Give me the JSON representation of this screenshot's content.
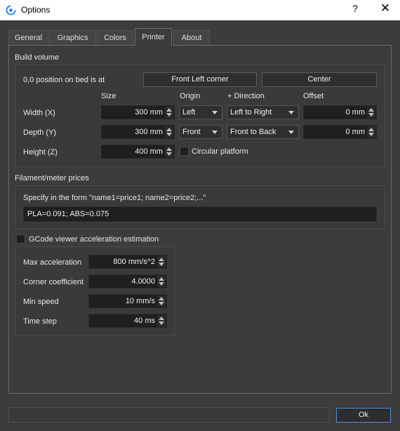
{
  "window": {
    "title": "Options",
    "help_glyph": "?",
    "close_glyph": "✕"
  },
  "tabs": [
    {
      "label": "General"
    },
    {
      "label": "Graphics"
    },
    {
      "label": "Colors"
    },
    {
      "label": "Printer",
      "active": true
    },
    {
      "label": "About"
    }
  ],
  "build_volume": {
    "title": "Build volume",
    "origin_position_label": "0,0 position on bed is at",
    "origin_buttons": [
      "Front Left corner",
      "Center"
    ],
    "columns": {
      "size": "Size",
      "origin": "Origin",
      "direction": "+ Direction",
      "offset": "Offset"
    },
    "rows": {
      "width": {
        "label": "Width (X)",
        "size": "300 mm",
        "origin": "Left",
        "direction": "Left to Right",
        "offset": "0 mm"
      },
      "depth": {
        "label": "Depth (Y)",
        "size": "300 mm",
        "origin": "Front",
        "direction": "Front to Back",
        "offset": "0 mm"
      },
      "height": {
        "label": "Height (Z)",
        "size": "400 mm"
      }
    },
    "circular_platform": {
      "label": "Circular platform",
      "checked": false
    }
  },
  "filament": {
    "title": "Filament/meter prices",
    "hint": "Specify in the form \"name1=price1; name2=price2;...\"",
    "value": "PLA=0.091; ABS=0.075"
  },
  "gcode_viewer": {
    "title": "GCode viewer acceleration estimation",
    "checked": false,
    "max_acceleration": {
      "label": "Max acceleration",
      "value": "800 mm/s^2"
    },
    "corner_coefficient": {
      "label": "Corner coefficient",
      "value": "4.0000"
    },
    "min_speed": {
      "label": "Min speed",
      "value": "10 mm/s"
    },
    "time_step": {
      "label": "Time step",
      "value": "40 ms"
    }
  },
  "footer": {
    "ok_label": "Ok"
  },
  "colors": {
    "accent": "#4a8fd6",
    "window_bg": "#3c3c3c",
    "field_bg": "#1f1f1f"
  }
}
